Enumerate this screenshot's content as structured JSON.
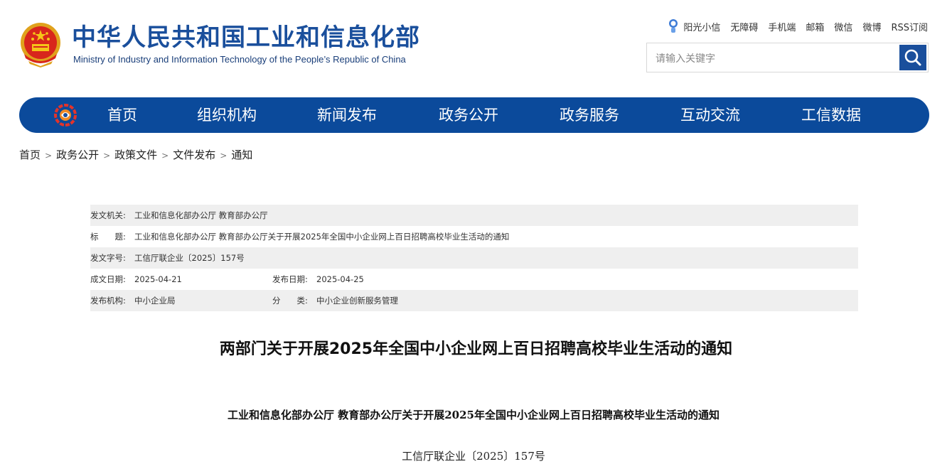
{
  "header": {
    "title_cn": "中华人民共和国工业和信息化部",
    "title_en": "Ministry of Industry and Information Technology of the People’s Republic of China",
    "emblem_icon": "national-emblem-icon"
  },
  "top_links": [
    "阳光小信",
    "无障碍",
    "手机端",
    "邮箱",
    "微信",
    "微博",
    "RSS订阅"
  ],
  "search": {
    "placeholder": "请输入关键字",
    "icon": "search-icon"
  },
  "nav": {
    "items": [
      "首页",
      "组织机构",
      "新闻发布",
      "政务公开",
      "政务服务",
      "互动交流",
      "工信数据"
    ],
    "color": "#0b4a9b"
  },
  "breadcrumb": [
    "首页",
    "政务公开",
    "政策文件",
    "文件发布",
    "通知"
  ],
  "info": {
    "issuer_label": "发文机关:",
    "issuer": "工业和信息化部办公厅 教育部办公厅",
    "title_label": "标　　题:",
    "title": "工业和信息化部办公厅 教育部办公厅关于开展2025年全国中小企业网上百日招聘高校毕业生活动的通知",
    "doc_no_label": "发文字号:",
    "doc_no": "工信厅联企业〔2025〕157号",
    "written_label": "成文日期:",
    "written_date": "2025-04-21",
    "published_label": "发布日期:",
    "published_date": "2025-04-25",
    "org_label": "发布机构:",
    "org": "中小企业局",
    "category_label": "分　　类:",
    "category": "中小企业创新服务管理"
  },
  "article": {
    "title": "两部门关于开展2025年全国中小企业网上百日招聘高校毕业生活动的通知",
    "subtitle": "工业和信息化部办公厅  教育部办公厅关于开展2025年全国中小企业网上百日招聘高校毕业生活动的通知",
    "doc_no": "工信厅联企业〔2025〕157号"
  }
}
